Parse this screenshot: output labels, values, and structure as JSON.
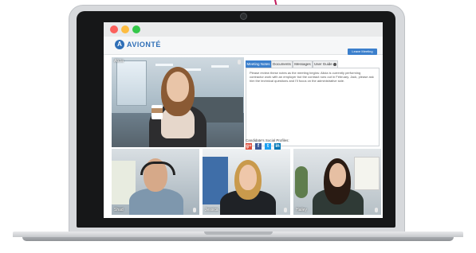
{
  "window": {
    "brand": "AVIONTÉ",
    "logo_letter": "A",
    "leave_meeting_label": "Leave Meeting"
  },
  "main_video": {
    "participant_name": "Alicia"
  },
  "thumbnails": [
    {
      "participant_name": "Shad"
    },
    {
      "participant_name": "Jessica"
    },
    {
      "participant_name": "Hailey"
    }
  ],
  "tabs": [
    {
      "label": "Meeting Notes",
      "active": true
    },
    {
      "label": "Documents",
      "active": false
    },
    {
      "label": "Messages",
      "active": false
    },
    {
      "label": "User Guide",
      "active": false
    }
  ],
  "notes": {
    "text": "Please review these notes as the meeting begins: Alicia is currently performing contractor work with an employer but the contract runs out in February. Jack, please ask him the technical questions and I'll focus on the administrative side."
  },
  "social": {
    "label": "Candidate's Social Profiles:",
    "profiles": [
      {
        "name": "google-plus-icon",
        "glyph": "g+",
        "color": "#dd4b39"
      },
      {
        "name": "facebook-icon",
        "glyph": "f",
        "color": "#3b5998"
      },
      {
        "name": "twitter-icon",
        "glyph": "t",
        "color": "#1da1f2"
      },
      {
        "name": "linkedin-icon",
        "glyph": "in",
        "color": "#0077b5"
      }
    ]
  },
  "colors": {
    "accent": "#3b7fcc",
    "pointer": "#c2185b"
  }
}
